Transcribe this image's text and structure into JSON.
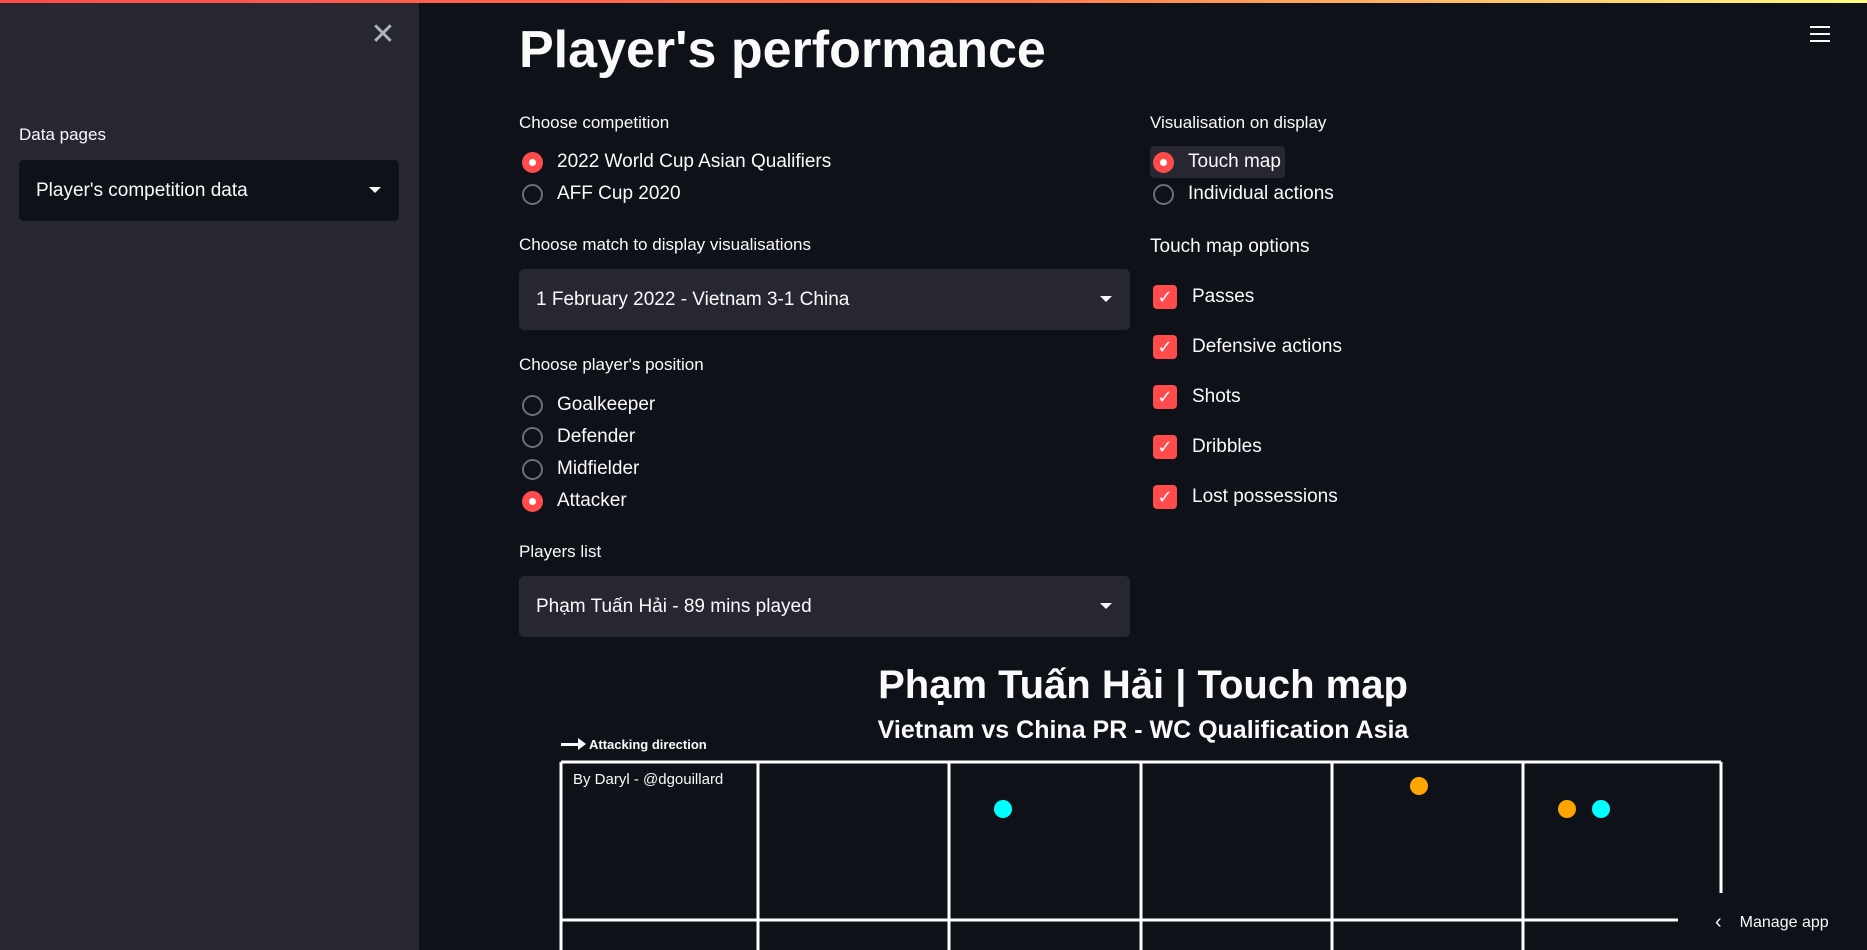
{
  "sidebar": {
    "close_icon": "close-icon",
    "data_pages_label": "Data pages",
    "data_pages_value": "Player's competition data"
  },
  "header": {
    "title": "Player's performance",
    "menu_icon": "hamburger-menu-icon"
  },
  "competition": {
    "label": "Choose competition",
    "options": [
      "2022 World Cup Asian Qualifiers",
      "AFF Cup 2020"
    ],
    "selected": "2022 World Cup Asian Qualifiers"
  },
  "match": {
    "label": "Choose match to display visualisations",
    "value": "1 February 2022 - Vietnam 3-1 China"
  },
  "position": {
    "label": "Choose player's position",
    "options": [
      "Goalkeeper",
      "Defender",
      "Midfielder",
      "Attacker"
    ],
    "selected": "Attacker"
  },
  "players": {
    "label": "Players list",
    "value": "Phạm Tuấn Hải - 89 mins played"
  },
  "visualisation": {
    "label": "Visualisation on display",
    "options": [
      "Touch map",
      "Individual actions"
    ],
    "selected": "Touch map"
  },
  "touch_map_options": {
    "label": "Touch map options",
    "items": [
      "Passes",
      "Defensive actions",
      "Shots",
      "Dribbles",
      "Lost possessions"
    ],
    "checked": [
      true,
      true,
      true,
      true,
      true
    ]
  },
  "chart": {
    "title": "Phạm Tuấn Hải | Touch map",
    "subtitle": "Vietnam vs China PR - WC Qualification Asia",
    "attacking_direction": "Attacking direction",
    "credit": "By Daryl - @dgouillard",
    "colors": {
      "orange": "#ffa500",
      "cyan": "#00ffff",
      "lines": "#ffffff"
    }
  },
  "manage_app": {
    "label": "Manage app",
    "icon": "chevron-left-icon"
  }
}
